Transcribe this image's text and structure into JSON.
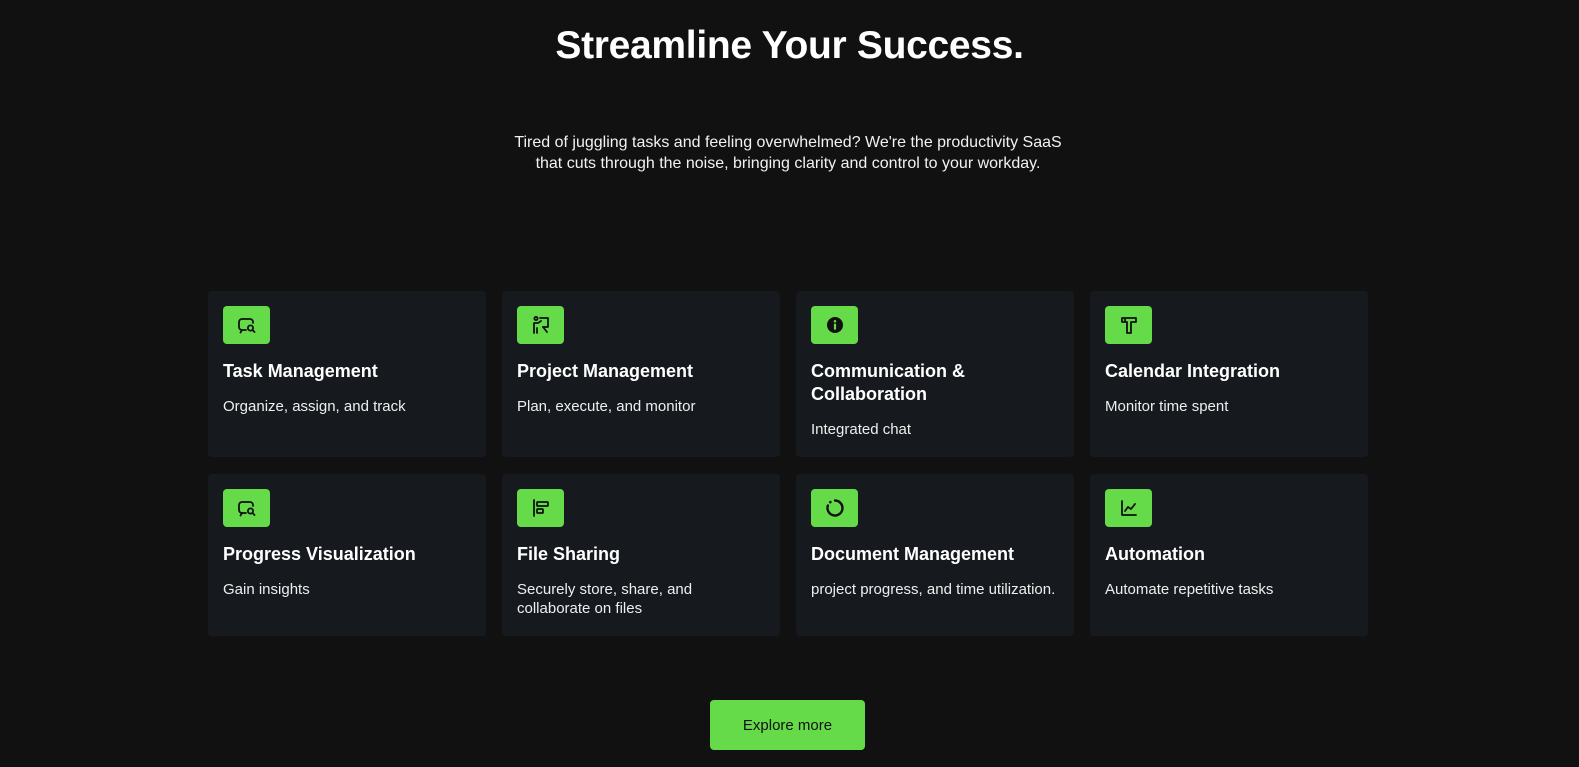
{
  "hero": {
    "title": "Streamline Your Success.",
    "subtitle": "Tired of juggling tasks and feeling overwhelmed? We're the productivity SaaS that cuts through the noise, bringing clarity and control to your workday."
  },
  "accent_color": "#65db4a",
  "features": [
    {
      "icon": "search-chat-icon",
      "title": "Task Management",
      "description": "Organize, assign, and track"
    },
    {
      "icon": "presentation-icon",
      "title": "Project Management",
      "description": "Plan, execute, and monitor"
    },
    {
      "icon": "info-icon",
      "title": "Communication & Collaboration",
      "description": "Integrated chat"
    },
    {
      "icon": "hammer-icon",
      "title": "Calendar Integration",
      "description": "Monitor time spent"
    },
    {
      "icon": "search-chat-icon",
      "title": "Progress Visualization",
      "description": "Gain insights"
    },
    {
      "icon": "align-left-icon",
      "title": "File Sharing",
      "description": "Securely store, share, and collaborate on files"
    },
    {
      "icon": "loading-circle-icon",
      "title": "Document Management",
      "description": "project progress, and time utilization."
    },
    {
      "icon": "line-chart-icon",
      "title": "Automation",
      "description": "Automate repetitive tasks"
    }
  ],
  "cta": {
    "label": "Explore more"
  }
}
